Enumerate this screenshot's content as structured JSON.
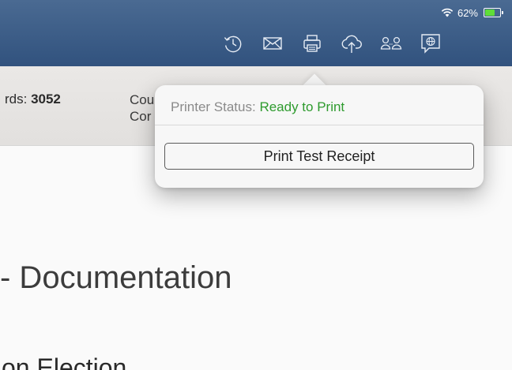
{
  "status_bar": {
    "battery_percent": "62%",
    "battery_level": 0.62,
    "wifi_icon": "wifi-icon",
    "battery_icon": "battery-charging-icon"
  },
  "toolbar": {
    "items": [
      {
        "name": "history",
        "icon": "history-icon"
      },
      {
        "name": "mail",
        "icon": "envelope-icon"
      },
      {
        "name": "print",
        "icon": "printer-icon"
      },
      {
        "name": "cloud",
        "icon": "cloud-upload-icon"
      },
      {
        "name": "users",
        "icon": "users-icon"
      },
      {
        "name": "language",
        "icon": "globe-chat-icon"
      }
    ]
  },
  "info_bar": {
    "records_label": "rds: ",
    "records_value": "3052",
    "right_line1": "Cou",
    "right_line2": "Cor"
  },
  "page": {
    "title": "- Documentation",
    "subtitle": "on Election"
  },
  "popover": {
    "status_label": "Printer Status: ",
    "status_value": "Ready to Print",
    "button_label": "Print Test Receipt"
  },
  "colors": {
    "header": "#3d5e88",
    "status_ready": "#2e9b2e",
    "battery_fill": "#5fdd39"
  }
}
